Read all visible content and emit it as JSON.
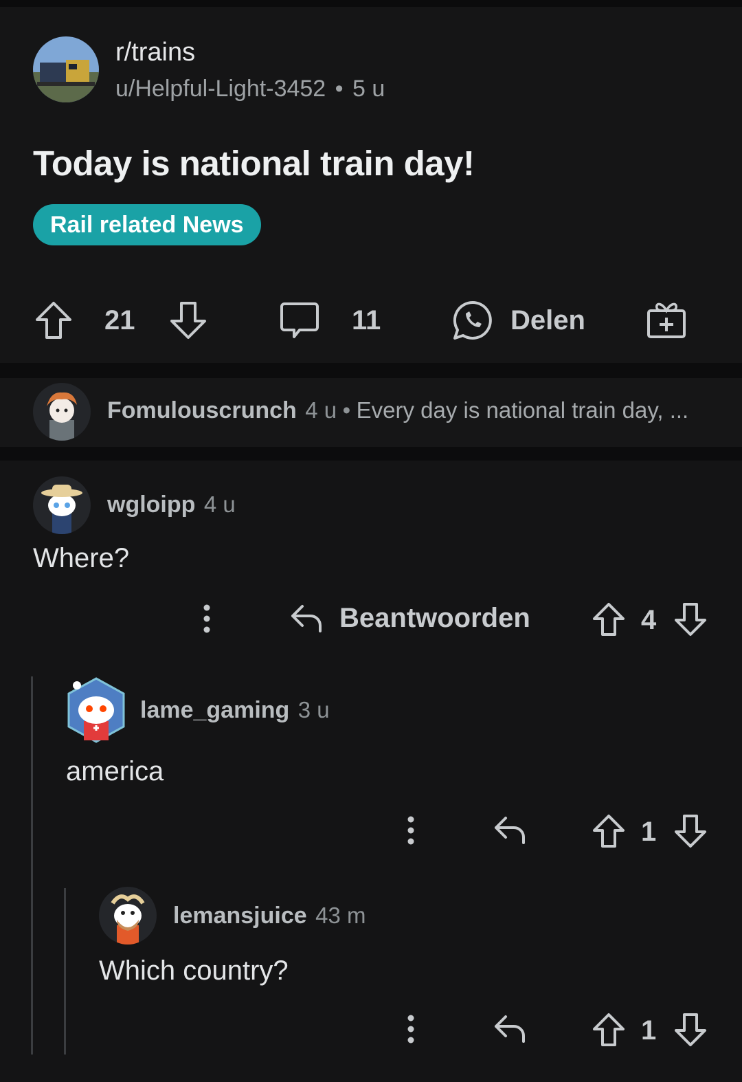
{
  "post": {
    "subreddit": "r/trains",
    "author": "u/Helpful-Light-3452",
    "separator": "•",
    "age": "5 u",
    "title": "Today is national train day!",
    "flair": "Rail related News",
    "flair_color": "#1aa2a6",
    "votes": "21",
    "comments": "11",
    "share_label": "Delen"
  },
  "collapsed_comment": {
    "user": "Fomulouscrunch",
    "age": "4 u",
    "separator": "•",
    "preview": "Every day is national train day, ..."
  },
  "comments": [
    {
      "user": "wgloipp",
      "age": "4 u",
      "text": "Where?",
      "reply_label": "Beantwoorden",
      "votes": "4"
    },
    {
      "user": "lame_gaming",
      "age": "3 u",
      "text": "america",
      "votes": "1"
    },
    {
      "user": "lemansjuice",
      "age": "43 m",
      "text": "Which country?",
      "votes": "1"
    }
  ],
  "icons": [
    "upvote-icon",
    "downvote-icon",
    "comment-icon",
    "whatsapp-icon",
    "award-icon",
    "more-icon",
    "reply-icon"
  ]
}
